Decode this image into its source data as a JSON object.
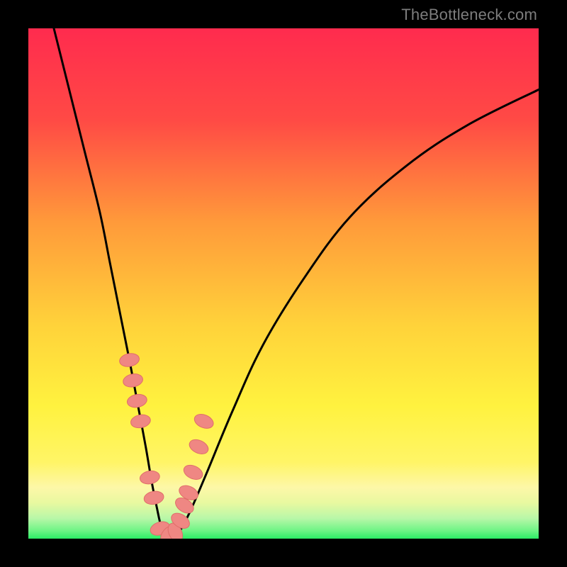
{
  "watermark": "TheBottleneck.com",
  "colors": {
    "frame": "#000000",
    "curve": "#000000",
    "marker_fill": "#ef8783",
    "marker_stroke": "#e06e6a",
    "grad_top": "#ff2b4e",
    "grad_mid1": "#ff7d3e",
    "grad_mid2": "#ffd23a",
    "grad_yellow": "#fff23f",
    "grad_yellow_pale": "#fdf7a8",
    "grad_green_pale": "#b9f7a8",
    "grad_green": "#2bed65"
  },
  "chart_data": {
    "type": "line",
    "title": "",
    "xlabel": "",
    "ylabel": "",
    "xlim": [
      0,
      100
    ],
    "ylim": [
      0,
      100
    ],
    "note": "V-shaped bottleneck curve; y ≈ mismatch %. Values read from pixel positions (no axis ticks shown).",
    "series": [
      {
        "name": "bottleneck-curve",
        "x": [
          5,
          8,
          11,
          14,
          16,
          18,
          20,
          21.5,
          23,
          24.2,
          25.2,
          26,
          27,
          28.5,
          30,
          32,
          35,
          40,
          46,
          54,
          63,
          74,
          86,
          100
        ],
        "values": [
          100,
          88,
          76,
          64,
          54,
          44,
          34,
          26,
          18,
          11,
          6,
          2.5,
          0.5,
          0.5,
          2,
          6,
          13,
          25,
          38,
          51,
          63,
          73,
          81,
          88
        ]
      }
    ],
    "markers": {
      "name": "highlighted-points",
      "x": [
        19.8,
        20.5,
        21.3,
        22.0,
        23.8,
        24.6,
        25.8,
        27.5,
        28.8,
        29.8,
        30.6,
        31.4,
        32.3,
        33.4,
        34.4
      ],
      "values": [
        35,
        31,
        27,
        23,
        12,
        8,
        2,
        0.8,
        1.2,
        3.5,
        6.5,
        9,
        13,
        18,
        23
      ]
    }
  }
}
